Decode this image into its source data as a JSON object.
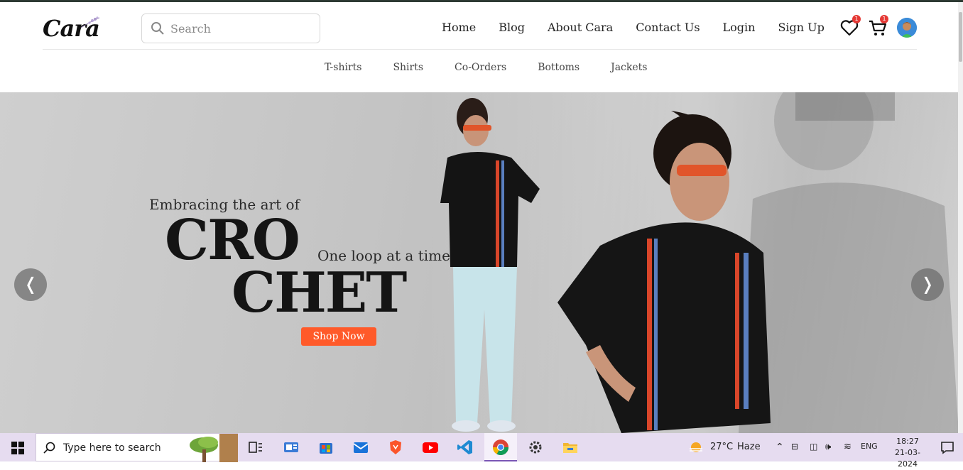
{
  "brand": {
    "logo_text": "Cara"
  },
  "search": {
    "placeholder": "Search"
  },
  "nav": {
    "items": [
      "Home",
      "Blog",
      "About Cara",
      "Contact Us",
      "Login",
      "Sign Up"
    ]
  },
  "header_icons": {
    "wishlist_count": "1",
    "cart_count": "1"
  },
  "categories": [
    "T-shirts",
    "Shirts",
    "Co-Orders",
    "Bottoms",
    "Jackets"
  ],
  "hero": {
    "tagline_top": "Embracing the art of",
    "headline_1": "CRO",
    "headline_2": "CHET",
    "tagline_side": "One loop at a time",
    "cta_label": "Shop Now",
    "prev_label": "❬",
    "next_label": "❭"
  },
  "taskbar": {
    "search_text": "Type here to search",
    "weather_temp": "27°C",
    "weather_desc": "Haze",
    "language": "ENG",
    "time": "18:27",
    "date": "21-03-2024"
  },
  "colors": {
    "cta": "#ff5a2a",
    "badge": "#e53935",
    "taskbar": "#e6dcf0"
  }
}
